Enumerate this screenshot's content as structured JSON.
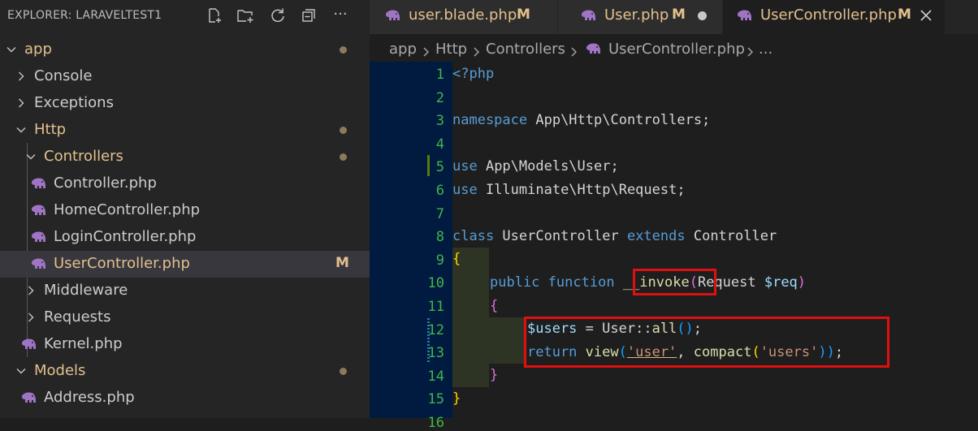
{
  "explorer": {
    "title": "EXPLORER: LARAVELTEST1",
    "actions": [
      "new-file-icon",
      "new-folder-icon",
      "refresh-icon",
      "collapse-all-icon",
      "more-icon"
    ],
    "more_label": "···"
  },
  "tree": [
    {
      "label": "app",
      "kind": "folder",
      "expanded": true,
      "modified": true
    },
    {
      "label": "Console",
      "kind": "folder",
      "expanded": false
    },
    {
      "label": "Exceptions",
      "kind": "folder",
      "expanded": false
    },
    {
      "label": "Http",
      "kind": "folder",
      "expanded": true,
      "modified": true
    },
    {
      "label": "Controllers",
      "kind": "folder",
      "expanded": true,
      "modified": true
    },
    {
      "label": "Controller.php",
      "kind": "file"
    },
    {
      "label": "HomeController.php",
      "kind": "file"
    },
    {
      "label": "LoginController.php",
      "kind": "file"
    },
    {
      "label": "UserController.php",
      "kind": "file",
      "selected": true,
      "badge": "M"
    },
    {
      "label": "Middleware",
      "kind": "folder",
      "expanded": false
    },
    {
      "label": "Requests",
      "kind": "folder",
      "expanded": false
    },
    {
      "label": "Kernel.php",
      "kind": "file"
    },
    {
      "label": "Models",
      "kind": "folder",
      "expanded": true,
      "modified": true
    },
    {
      "label": "Address.php",
      "kind": "file"
    }
  ],
  "tabs": [
    {
      "label": "user.blade.php",
      "badge": "M",
      "active": false
    },
    {
      "label": "User.php",
      "badge": "M",
      "active": false,
      "dirty": true
    },
    {
      "label": "UserController.php",
      "badge": "M",
      "active": true
    }
  ],
  "breadcrumb": [
    "app",
    "Http",
    "Controllers",
    "UserController.php",
    "..."
  ],
  "editor": {
    "line_numbers": [
      "1",
      "2",
      "3",
      "4",
      "5",
      "6",
      "7",
      "8",
      "9",
      "10",
      "11",
      "12",
      "13",
      "14",
      "15",
      "16"
    ],
    "lines": {
      "l1": "<?php",
      "l3_kw": "namespace",
      "l3_rest": " App\\Http\\Controllers;",
      "l5_kw": "use",
      "l5_rest": " App\\Models\\User;",
      "l6_kw": "use",
      "l6_rest": " Illuminate\\Http\\Request;",
      "l8_kw1": "class",
      "l8_cls": " UserController ",
      "l8_kw2": "extends",
      "l8_rest": " Controller",
      "l9": "{",
      "l10_kw1": "public",
      "l10_kw2": "function",
      "l10_fn": "__invoke",
      "l10_p1": "(",
      "l10_type": "Request ",
      "l10_var": "$req",
      "l10_p2": ")",
      "l11": "{",
      "l12_var": "$users",
      "l12_eq": " = ",
      "l12_cls": "User",
      "l12_op": "::",
      "l12_fn": "all",
      "l12_p": "()",
      "l12_semi": ";",
      "l13_kw": "return",
      "l13_fn": "view",
      "l13_p1": "(",
      "l13_str": "'user'",
      "l13_comma": ", ",
      "l13_fn2": "compact",
      "l13_p2": "(",
      "l13_str2": "'users'",
      "l13_p3": "))",
      "l13_semi": ";",
      "l14": "}",
      "l15": "}"
    }
  },
  "colors": {
    "gutter_bg": "#001a40",
    "line_number": "#41b64a",
    "annotation": "#e01010",
    "modified": "#e2c08d"
  }
}
